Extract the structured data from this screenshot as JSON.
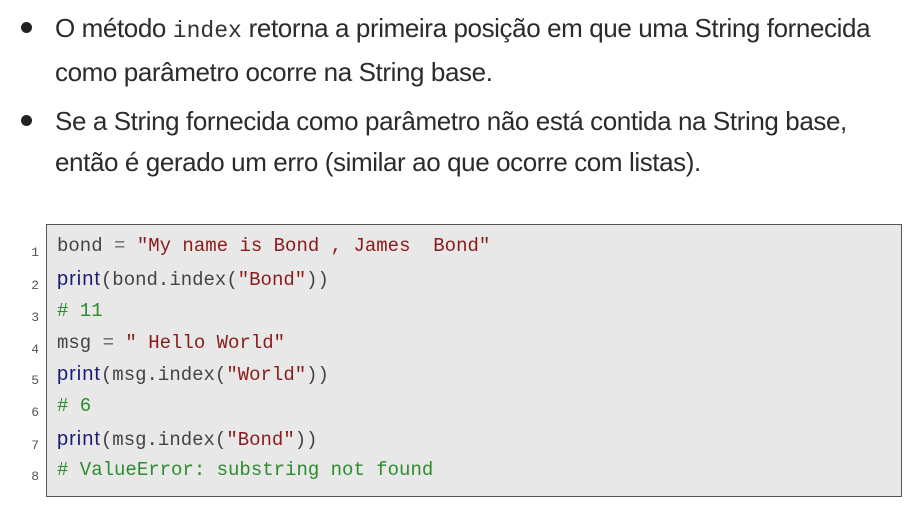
{
  "bullets": [
    {
      "pre": "O método ",
      "code": "index",
      "post": " retorna a primeira posição em que uma String fornecida como parâmetro ocorre na String base."
    },
    {
      "text": "Se a String fornecida como parâmetro não está contida na String base, então é gerado um erro (similar ao que ocorre com listas)."
    }
  ],
  "code": {
    "lines": [
      {
        "num": "1",
        "tokens": [
          {
            "t": "bond ",
            "c": "plain"
          },
          {
            "t": "=",
            "c": "op"
          },
          {
            "t": " ",
            "c": "plain"
          },
          {
            "t": "\"My name is Bond , James  Bond\"",
            "c": "str"
          }
        ]
      },
      {
        "num": "2",
        "tokens": [
          {
            "t": "print",
            "c": "fn"
          },
          {
            "t": "(bond.index(",
            "c": "plain"
          },
          {
            "t": "\"Bond\"",
            "c": "str"
          },
          {
            "t": "))",
            "c": "plain"
          }
        ]
      },
      {
        "num": "3",
        "tokens": [
          {
            "t": "# 11",
            "c": "com"
          }
        ]
      },
      {
        "num": "4",
        "tokens": [
          {
            "t": "msg ",
            "c": "plain"
          },
          {
            "t": "=",
            "c": "op"
          },
          {
            "t": " ",
            "c": "plain"
          },
          {
            "t": "\" Hello World\"",
            "c": "str"
          }
        ]
      },
      {
        "num": "5",
        "tokens": [
          {
            "t": "print",
            "c": "fn"
          },
          {
            "t": "(msg.index(",
            "c": "plain"
          },
          {
            "t": "\"World\"",
            "c": "str"
          },
          {
            "t": "))",
            "c": "plain"
          }
        ]
      },
      {
        "num": "6",
        "tokens": [
          {
            "t": "# 6",
            "c": "com"
          }
        ]
      },
      {
        "num": "7",
        "tokens": [
          {
            "t": "print",
            "c": "fn"
          },
          {
            "t": "(msg.index(",
            "c": "plain"
          },
          {
            "t": "\"Bond\"",
            "c": "str"
          },
          {
            "t": "))",
            "c": "plain"
          }
        ]
      },
      {
        "num": "8",
        "tokens": [
          {
            "t": "# ValueError: substring not found",
            "c": "com"
          }
        ]
      }
    ]
  }
}
